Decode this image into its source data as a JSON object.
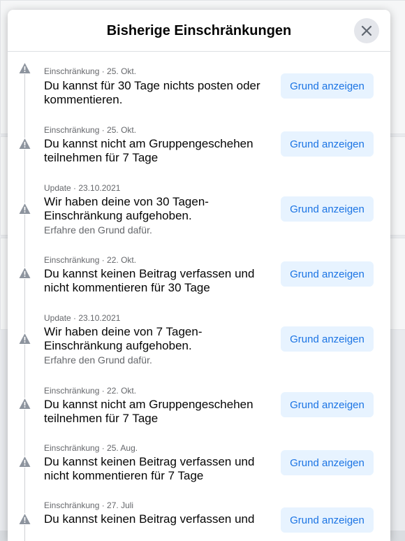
{
  "modal": {
    "title": "Bisherige Einschränkungen",
    "close_icon": "close-icon",
    "entry_icon": "warning-icon"
  },
  "entries": [
    {
      "meta": "Einschränkung · 25. Okt.",
      "text": "Du kannst für 30 Tage nichts posten oder kommentieren.",
      "sub": "",
      "button": "Grund anzeigen"
    },
    {
      "meta": "Einschränkung · 25. Okt.",
      "text": "Du kannst nicht am Gruppengeschehen teilnehmen für 7 Tage",
      "sub": "",
      "button": "Grund anzeigen"
    },
    {
      "meta": "Update · 23.10.2021",
      "text": "Wir haben deine von 30 Tagen-Einschränkung aufgehoben.",
      "sub": "Erfahre den Grund dafür.",
      "button": "Grund anzeigen"
    },
    {
      "meta": "Einschränkung · 22. Okt.",
      "text": "Du kannst keinen Beitrag verfassen und nicht kommentieren für 30 Tage",
      "sub": "",
      "button": "Grund anzeigen"
    },
    {
      "meta": "Update · 23.10.2021",
      "text": "Wir haben deine von 7 Tagen-Einschränkung aufgehoben.",
      "sub": "Erfahre den Grund dafür.",
      "button": "Grund anzeigen"
    },
    {
      "meta": "Einschränkung · 22. Okt.",
      "text": "Du kannst nicht am Gruppengeschehen teilnehmen für 7 Tage",
      "sub": "",
      "button": "Grund anzeigen"
    },
    {
      "meta": "Einschränkung · 25. Aug.",
      "text": "Du kannst keinen Beitrag verfassen und nicht kommentieren für 7 Tage",
      "sub": "",
      "button": "Grund anzeigen"
    },
    {
      "meta": "Einschränkung · 27. Juli",
      "text": "Du kannst keinen Beitrag verfassen und",
      "sub": "",
      "button": "Grund anzeigen"
    }
  ]
}
